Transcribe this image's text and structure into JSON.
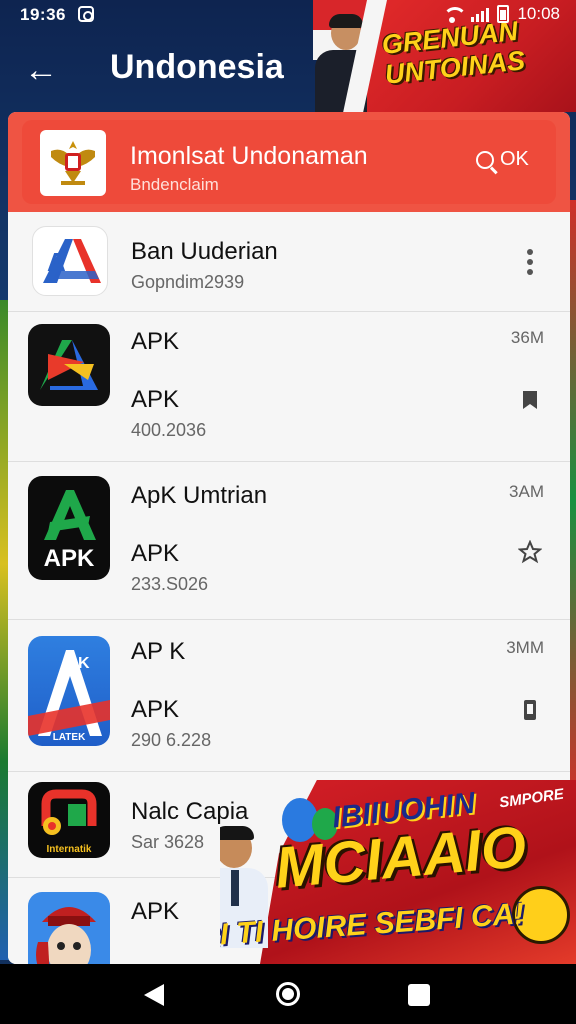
{
  "status_bar": {
    "time": "19:36",
    "right_text": "10:08"
  },
  "header": {
    "title": "Undonesia"
  },
  "top_promo": {
    "text": "GRENUAN UNTOINAS"
  },
  "app_bar": {
    "name": "Imonlsat Undonaman",
    "subtitle": "Bndenclaim",
    "search_label": "OK"
  },
  "list": [
    {
      "title": "Ban Uuderian",
      "subtitle": "Gopndim2939",
      "size": "",
      "sub_title": "",
      "action": "more-vert-icon"
    },
    {
      "title": "APK",
      "sub_title": "APK",
      "subtitle": "400.2036",
      "size": "36M",
      "action": "bookmark-icon"
    },
    {
      "title": "ApK Umtrian",
      "sub_title": "APK",
      "subtitle": "233.S026",
      "size": "3AM",
      "action": "star-icon"
    },
    {
      "title": "AP K",
      "sub_title": "APK",
      "subtitle": "290 6.228",
      "size": "3MM",
      "action": "phone-icon"
    },
    {
      "title": "Nalc Capia",
      "sub_title": "",
      "subtitle": "Sar 3628",
      "size": "",
      "action": ""
    },
    {
      "title": "APK",
      "sub_title": "",
      "subtitle": "",
      "size": "",
      "action": ""
    }
  ],
  "bottom_promo": {
    "small": "SMPORE",
    "line1": "IBIIUOHIN",
    "line2": "MCIAAIO",
    "line3": "LARI TI HOIRE SEBFI CA!"
  },
  "icon_texts": {
    "apk2": "APK",
    "apk4": "LATEK",
    "app5": "Internatik"
  },
  "colors": {
    "accent": "#ef5443",
    "header_bg": "#0e2450",
    "promo_yellow": "#ffd21a"
  }
}
